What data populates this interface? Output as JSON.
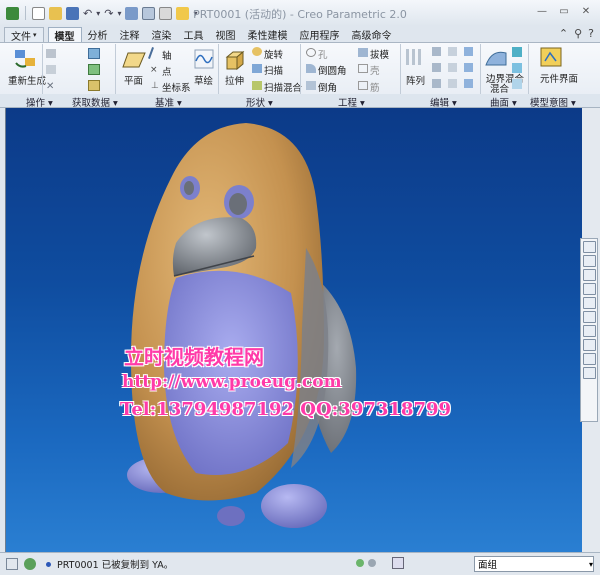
{
  "window": {
    "title": "PRT0001 (活动的) - Creo Parametric 2.0"
  },
  "menu_tabs": [
    "文件",
    "模型",
    "分析",
    "注释",
    "渲染",
    "工具",
    "视图",
    "柔性建模",
    "应用程序",
    "高级命令"
  ],
  "active_tab": "模型",
  "ribbon": {
    "regenerate": "重新生成",
    "axis": "轴",
    "point": "点",
    "csys": "坐标系",
    "plane": "平面",
    "sketch": "草绘",
    "extrude": "拉伸",
    "revolve": "旋转",
    "sweep": "扫描",
    "swept_blend": "扫描混合",
    "hole": "孔",
    "round": "倒圆角",
    "chamfer": "倒角",
    "draft": "拔模",
    "shell": "壳",
    "rib": "筋",
    "pattern": "阵列",
    "boundary_blend": "边界混合",
    "boundary_blend_line2": "混合",
    "component_interface": "元件界面"
  },
  "groups": {
    "operations": "操作",
    "get_data": "获取数据",
    "datum": "基准",
    "shapes": "形状",
    "engineering": "工程",
    "editing": "编辑",
    "surfaces": "曲面",
    "model_intent": "模型意图"
  },
  "watermark": {
    "line1": "立时视频教程网",
    "line2": "http://www.proeug.com",
    "line3": "Tel:13794987192  QQ:397318799"
  },
  "status": {
    "message": "PRT0001 已被复制到 YA。",
    "selection_filter": "面组"
  },
  "colors": {
    "viewport_top": "#0c3a88",
    "viewport_bottom": "#2a7fd2",
    "body_orange": "#c99a5a",
    "belly_purple": "#8d8fd8",
    "beak_gray": "#8a8f96",
    "watermark_pink": "#ff3aa8"
  }
}
